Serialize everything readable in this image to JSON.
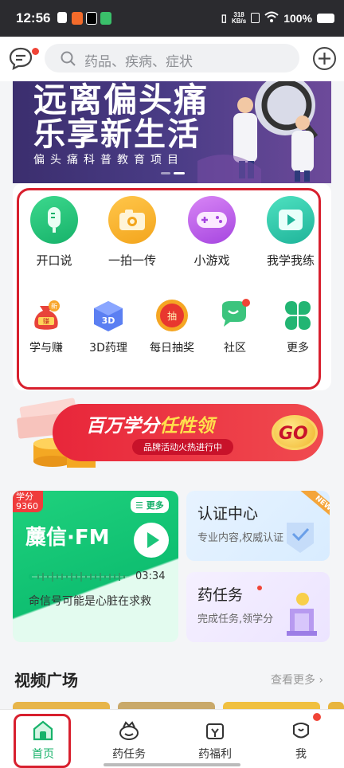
{
  "status_bar": {
    "time": "12:56",
    "net_speed_value": "318",
    "net_speed_unit": "KB/s",
    "battery": "100%"
  },
  "search": {
    "placeholder": "药品、疾病、症状"
  },
  "hero": {
    "line1": "远离偏头痛",
    "line2": "乐享新生活",
    "subtitle": "偏头痛科普教育项目"
  },
  "grid": {
    "row1": [
      {
        "label": "开口说",
        "icon": "microphone-icon",
        "color": "#1fbf74"
      },
      {
        "label": "一拍一传",
        "icon": "camera-icon",
        "color": "#f6a821"
      },
      {
        "label": "小游戏",
        "icon": "gamepad-icon",
        "color": "#b45be8"
      },
      {
        "label": "我学我练",
        "icon": "play-icon",
        "color": "#2dbf9f"
      }
    ],
    "row2": [
      {
        "label": "学与赚",
        "icon": "money-bag-icon",
        "badge": "新"
      },
      {
        "label": "3D药理",
        "icon": "cube-3d-icon",
        "badge_text": "3D"
      },
      {
        "label": "每日抽奖",
        "icon": "lottery-icon",
        "badge_text": "抽"
      },
      {
        "label": "社区",
        "icon": "chat-bubbles-icon"
      },
      {
        "label": "更多",
        "icon": "clover-icon"
      }
    ]
  },
  "promo": {
    "title_part1": "百万学分",
    "title_part2": "任性领",
    "subtitle": "品牌活动火热进行中",
    "go": "GO"
  },
  "fm_card": {
    "credit_label": "学分",
    "credit_value": "9360",
    "more": "更多",
    "title": "蘪信·FM",
    "time": "03:34",
    "desc": "命信号可能是心脏在求救"
  },
  "cert_card": {
    "title": "认证中心",
    "desc": "专业内容,权威认证",
    "ribbon": "NEW"
  },
  "task_card": {
    "title": "药任务",
    "desc": "完成任务,领学分"
  },
  "video_section": {
    "title": "视频广场",
    "more": "查看更多"
  },
  "bottom_nav": [
    {
      "label": "首页",
      "icon": "home-icon",
      "active": true
    },
    {
      "label": "药任务",
      "icon": "task-icon",
      "active": false
    },
    {
      "label": "药福利",
      "icon": "gift-icon",
      "active": false
    },
    {
      "label": "我",
      "icon": "profile-icon",
      "active": false
    }
  ]
}
